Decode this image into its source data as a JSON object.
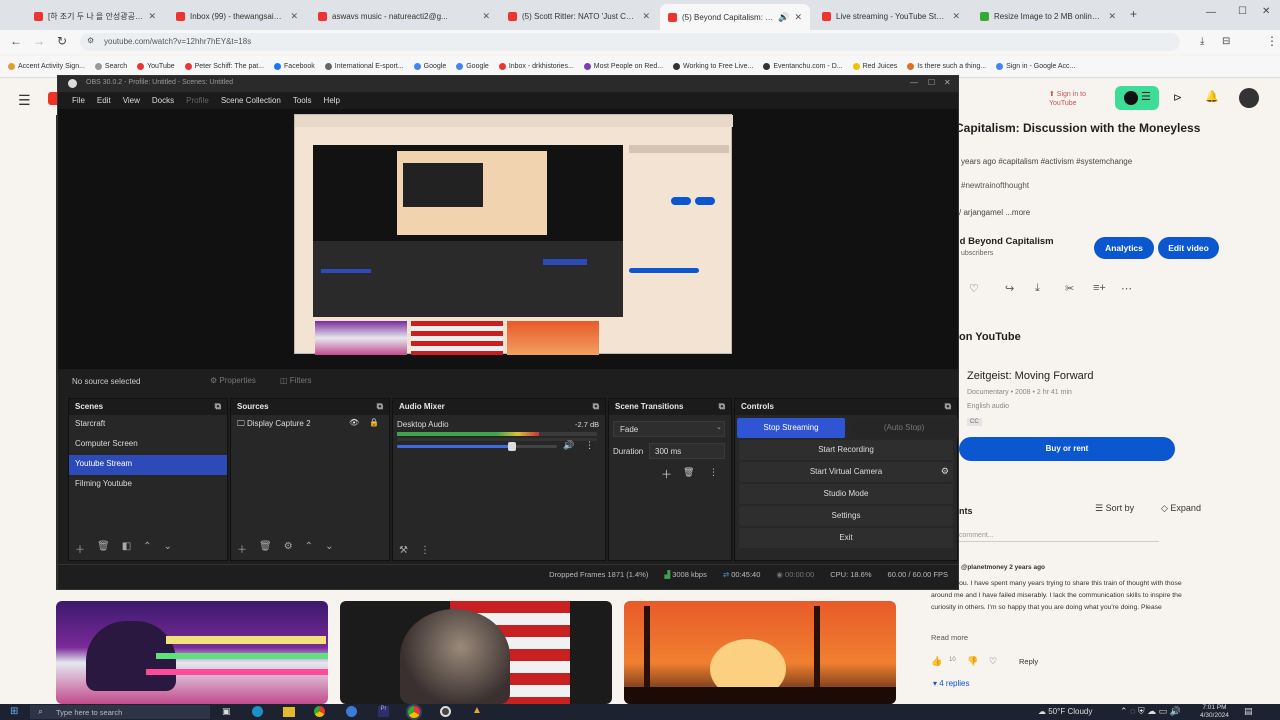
{
  "tabs": [
    {
      "label": "[하 조기 두 나 을 안성광공 ... ",
      "color": "#e33"
    },
    {
      "label": "Inbox (99) - thewangsaidfirst@gm...",
      "color": "#e33"
    },
    {
      "label": "aswavs music - natureacti2@g...",
      "color": "#e33"
    },
    {
      "label": "(5) Scott Ritter: NATO 'Just CROSS...",
      "color": "#e33"
    },
    {
      "label": "(5) Beyond Capitalism: Discu...",
      "color": "#e33",
      "active": true
    },
    {
      "label": "Live streaming - YouTube Studio",
      "color": "#e33"
    },
    {
      "label": "Resize Image to 2 MB online for ...",
      "color": "#3a3"
    }
  ],
  "address_bar": "youtube.com/watch?v=12hhr7hEY&t=18s",
  "bookmarks": [
    "Accent Activity Sign...",
    "Search",
    "YouTube",
    "Peter Schiff: The pat...",
    "Facebook",
    "International E-sport...",
    "Google",
    "Google",
    "Inbox - drkhistories...",
    "Most People on Red...",
    "Working to Free Live...",
    "Eventanchu.com - D...",
    "Red Juices",
    "Is there such a thing...",
    "Sign in - Google Acc..."
  ],
  "yt": {
    "video_title": "Capitalism: Discussion with the Moneyless",
    "meta": "years ago #capitalism #activism #systemchange",
    "hashtag": "#newtrainofthought",
    "more": "/ arjangamel  ...more",
    "channel": "ld Beyond Capitalism",
    "subscribers": "ubscribers",
    "analytics_btn": "Analytics",
    "edit_btn": "Edit video",
    "on_youtube": "on YouTube",
    "movie_title": "Zeitgeist: Moving Forward",
    "movie_meta": "Documentary • 2008 • 2 hr 41 min",
    "movie_audio": "English audio",
    "movie_badge": "CC",
    "buy_btn": "Buy or rent",
    "comments_label": "nts",
    "sort_by": "Sort by",
    "expand": "Expand",
    "add_comment": "comment...",
    "commenter": "@planetmoney 2 years ago",
    "comment_text": "I'm with you. I have spent many years trying to share this train of thought with those around me and I have failed miserably. I lack the communication skills to inspire the curiosity in others. I'm so happy that you are doing what you're doing. Please",
    "read_more": "Read more",
    "likes": "10",
    "reply": "Reply",
    "replies": "4 replies"
  },
  "obs": {
    "window_title": "OBS 30.0.2 - Profile: Untitled - Scenes: Untitled",
    "menu": [
      "File",
      "Edit",
      "View",
      "Docks",
      "Profile",
      "Scene Collection",
      "Tools",
      "Help"
    ],
    "no_source": "No source selected",
    "properties_btn": "Properties",
    "filters_btn": "Filters",
    "scenes_title": "Scenes",
    "scenes": [
      "Starcraft",
      "Computer Screen",
      "Youtube Stream",
      "Filming Youtube"
    ],
    "selected_scene": "Youtube Stream",
    "sources_title": "Sources",
    "sources": [
      "Display Capture 2"
    ],
    "audio_title": "Audio Mixer",
    "audio_channel": "Desktop Audio",
    "audio_db": "-2.7 dB",
    "audio_level": 0.71,
    "volume_level": 0.72,
    "transitions_title": "Scene Transitions",
    "transition": "Fade",
    "duration_label": "Duration",
    "duration_value": "300 ms",
    "controls_title": "Controls",
    "stop_streaming": "Stop Streaming",
    "auto_stop": "(Auto Stop)",
    "start_recording": "Start Recording",
    "virtual_camera": "Start Virtual Camera",
    "studio_mode": "Studio Mode",
    "settings": "Settings",
    "exit": "Exit",
    "dropped_frames": "Dropped Frames 1871 (1.4%)",
    "bitrate": "3008 kbps",
    "stream_time": "00:45:40",
    "rec_time": "00:00:00",
    "cpu": "CPU: 18.6%",
    "fps": "60.00 / 60.00 FPS"
  },
  "taskbar": {
    "search": "Type here to search",
    "weather": "50°F Cloudy",
    "time": "7:01 PM",
    "date": "4/30/2024"
  },
  "colors": {
    "yt_blue": "#0b57d0",
    "obs_select": "#2c4ab8",
    "obs_stream": "#2f55d4"
  }
}
